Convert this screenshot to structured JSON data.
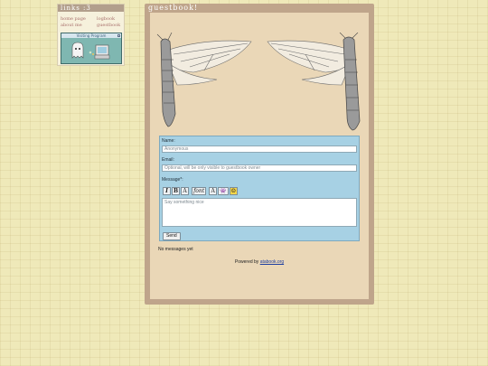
{
  "links_box": {
    "title": "links :3",
    "items": [
      "home page",
      "about me",
      "logbook",
      "guestbook"
    ],
    "badge_caption": "Visiting Program"
  },
  "guestbook": {
    "title": "guestbook!",
    "form": {
      "name_label": "Name:",
      "name_placeholder": "Anonymous",
      "email_label": "Email:",
      "email_placeholder": "Optional, will be only visible to guestbook owner",
      "message_label": "Message*:",
      "message_placeholder": "Say something nice",
      "toolbar": [
        "I",
        "B",
        "A",
        "font",
        "A",
        "👾",
        "☺"
      ],
      "send_label": "Send"
    },
    "empty_text": "No messages yet",
    "powered_prefix": "Powered by",
    "powered_link": "atabook.org"
  },
  "colors": {
    "frame": "#bfa58b",
    "panel": "#ead7b7",
    "form_bg": "#a7d1e4",
    "link_color": "#a8706c"
  }
}
